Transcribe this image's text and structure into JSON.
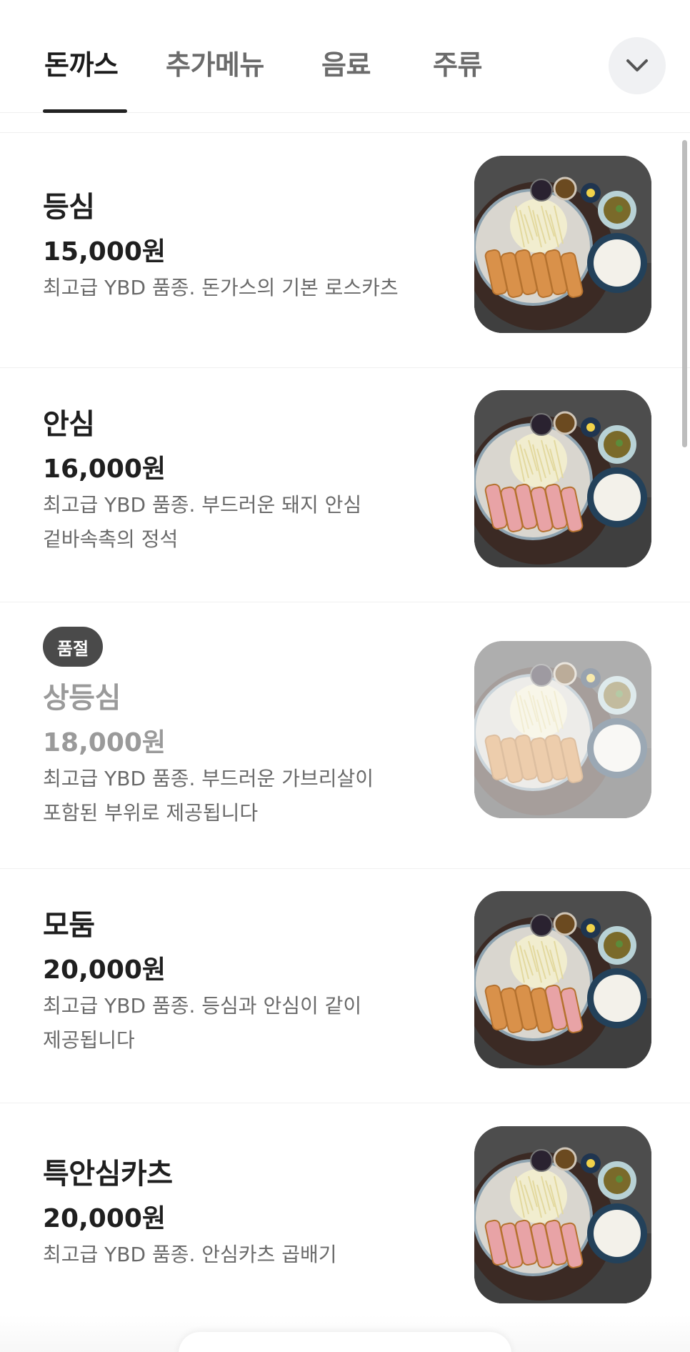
{
  "tabs": [
    {
      "label": "돈까스",
      "active": true
    },
    {
      "label": "추가메뉴",
      "active": false
    },
    {
      "label": "음료",
      "active": false
    },
    {
      "label": "주류",
      "active": false
    }
  ],
  "more_icon": "chevron-down-icon",
  "menu": [
    {
      "name": "등심",
      "price": "15,000원",
      "desc": [
        "최고급 YBD 품종. 돈가스의 기본 로스카츠"
      ],
      "sold_out": false,
      "dish": "fried"
    },
    {
      "name": "안심",
      "price": "16,000원",
      "desc": [
        "최고급 YBD 품종. 부드러운 돼지 안심",
        "겉바속촉의 정석"
      ],
      "sold_out": false,
      "dish": "pink"
    },
    {
      "badge": "품절",
      "name": "상등심",
      "price": "18,000원",
      "desc": [
        "최고급 YBD 품종. 부드러운 가브리살이",
        "포함된 부위로 제공됩니다"
      ],
      "sold_out": true,
      "dish": "fried"
    },
    {
      "name": "모둠",
      "price": "20,000원",
      "desc": [
        "최고급 YBD 품종. 등심과 안심이 같이",
        "제공됩니다"
      ],
      "sold_out": false,
      "dish": "mixed"
    },
    {
      "name": "특안심카츠",
      "price": "20,000원",
      "desc": [
        "최고급 YBD 품종. 안심카츠 곱배기"
      ],
      "sold_out": false,
      "dish": "pink"
    }
  ],
  "colors": {
    "active_tab": "#1c1c1c",
    "inactive_tab": "#6b6b6b",
    "badge_bg": "#4a4a4a",
    "cutlet_fried": "#d9914a",
    "cutlet_pink": "#e8a3a6"
  }
}
